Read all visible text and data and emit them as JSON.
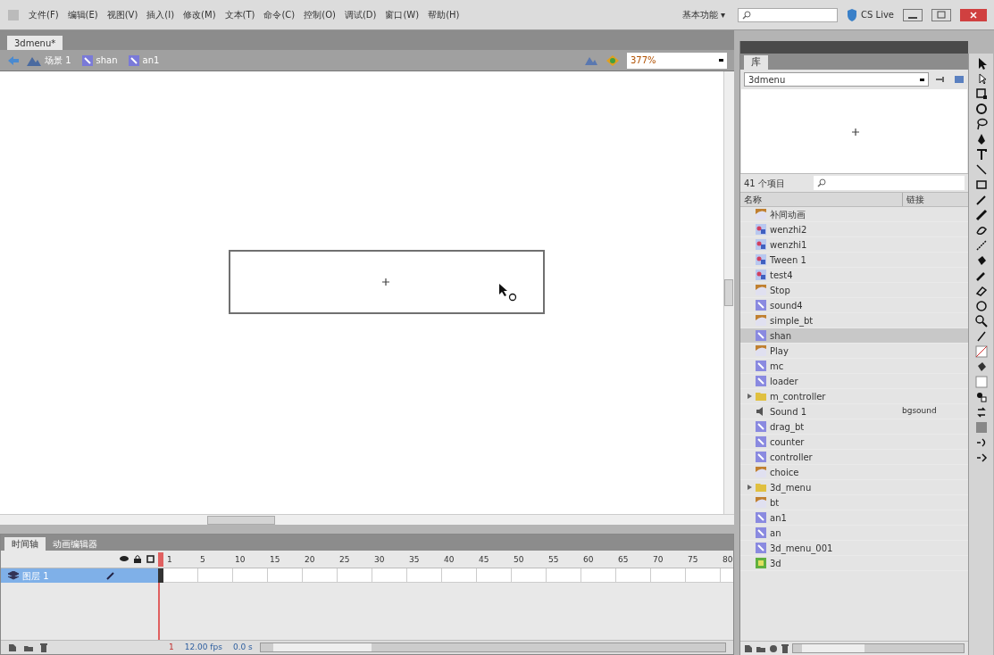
{
  "menu_bar": {
    "items": [
      "文件(F)",
      "编辑(E)",
      "视图(V)",
      "插入(I)",
      "修改(M)",
      "文本(T)",
      "命令(C)",
      "控制(O)",
      "调试(D)",
      "窗口(W)",
      "帮助(H)"
    ],
    "workspace": "基本功能 ▾",
    "cs_live": "CS Live"
  },
  "document_tabs": [
    {
      "label": "3dmenu*",
      "selected": true
    }
  ],
  "breadcrumb": [
    {
      "label": "场景 1",
      "kind": "scene"
    },
    {
      "label": "shan",
      "kind": "movieclip"
    },
    {
      "label": "an1",
      "kind": "movieclip"
    }
  ],
  "zoom": "377%",
  "timeline": {
    "tabs": [
      {
        "label": "时间轴",
        "selected": true
      },
      {
        "label": "动画编辑器",
        "selected": false
      }
    ],
    "frame_numbers": [
      "1",
      "5",
      "10",
      "15",
      "20",
      "25",
      "30",
      "35",
      "40",
      "45",
      "50",
      "55",
      "60",
      "65",
      "70",
      "75",
      "80"
    ],
    "layers": [
      {
        "name": "图层 1",
        "selected": true
      }
    ],
    "status": [
      "1",
      "12.00 fps",
      "0.0 s"
    ]
  },
  "library": {
    "title": "库",
    "document": "3dmenu",
    "count": "41 个项目",
    "columns": [
      "名称",
      "链接"
    ],
    "items": [
      {
        "name": "补间动画",
        "kind": "button",
        "selected": false
      },
      {
        "name": "wenzhi2",
        "kind": "graphic",
        "selected": false
      },
      {
        "name": "wenzhi1",
        "kind": "graphic",
        "selected": false
      },
      {
        "name": "Tween 1",
        "kind": "graphic",
        "selected": false
      },
      {
        "name": "test4",
        "kind": "graphic",
        "selected": false
      },
      {
        "name": "Stop",
        "kind": "button",
        "selected": false
      },
      {
        "name": "sound4",
        "kind": "movieclip",
        "selected": false
      },
      {
        "name": "simple_bt",
        "kind": "button",
        "selected": false
      },
      {
        "name": "shan",
        "kind": "movieclip",
        "selected": true
      },
      {
        "name": "Play",
        "kind": "button",
        "selected": false
      },
      {
        "name": "mc",
        "kind": "movieclip",
        "selected": false
      },
      {
        "name": "loader",
        "kind": "movieclip",
        "selected": false
      },
      {
        "name": "m_controller",
        "kind": "folder",
        "selected": false
      },
      {
        "name": "Sound 1",
        "kind": "sound",
        "selected": false,
        "linkage": "bgsound"
      },
      {
        "name": "drag_bt",
        "kind": "movieclip",
        "selected": false
      },
      {
        "name": "counter",
        "kind": "movieclip",
        "selected": false
      },
      {
        "name": "controller",
        "kind": "movieclip",
        "selected": false
      },
      {
        "name": "choice",
        "kind": "button",
        "selected": false
      },
      {
        "name": "3d_menu",
        "kind": "folder",
        "selected": false
      },
      {
        "name": "bt",
        "kind": "button",
        "selected": false
      },
      {
        "name": "an1",
        "kind": "movieclip",
        "selected": false
      },
      {
        "name": "an",
        "kind": "movieclip",
        "selected": false
      },
      {
        "name": "3d_menu_001",
        "kind": "movieclip",
        "selected": false
      },
      {
        "name": "3d",
        "kind": "bitmap",
        "selected": false
      }
    ]
  }
}
